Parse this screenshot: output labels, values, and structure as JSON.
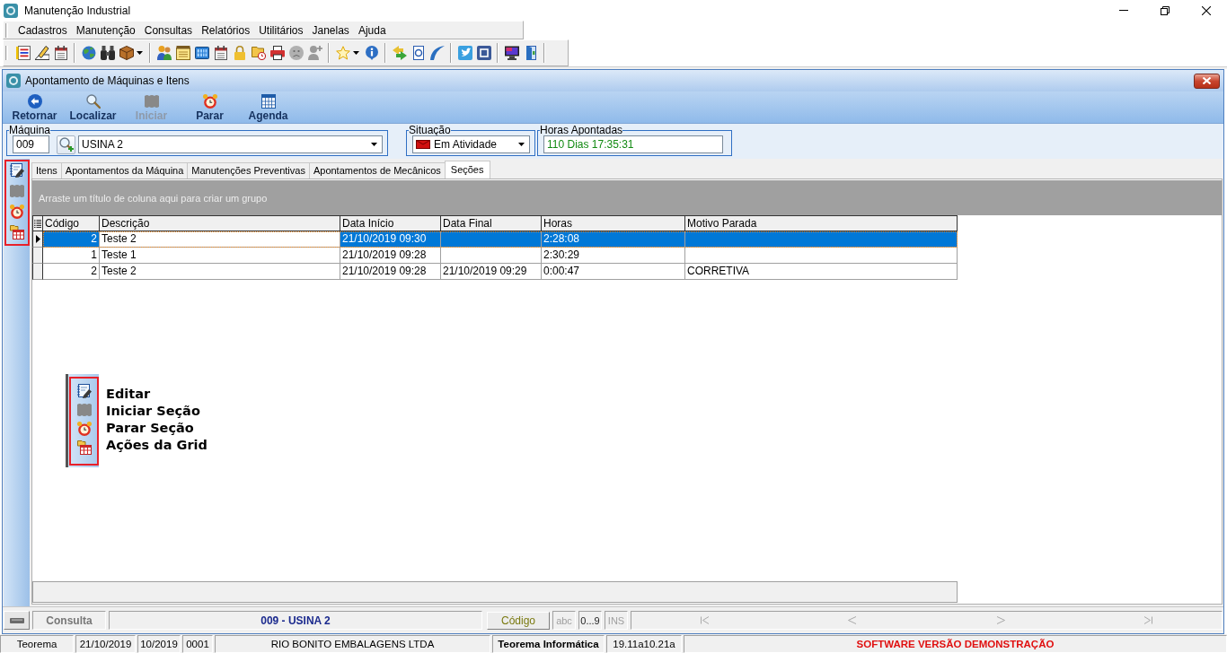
{
  "window": {
    "title": "Manutenção Industrial"
  },
  "menu": [
    {
      "label": "Cadastros"
    },
    {
      "label": "Manutenção"
    },
    {
      "label": "Consultas"
    },
    {
      "label": "Relatórios"
    },
    {
      "label": "Utilitários"
    },
    {
      "label": "Janelas"
    },
    {
      "label": "Ajuda"
    }
  ],
  "form": {
    "title": "Apontamento de Máquinas e Itens",
    "toolbar": [
      {
        "label": "Retornar",
        "disabled": false
      },
      {
        "label": "Localizar",
        "disabled": false
      },
      {
        "label": "Iniciar",
        "disabled": true
      },
      {
        "label": "Parar",
        "disabled": false
      },
      {
        "label": "Agenda",
        "disabled": false
      }
    ],
    "machine": {
      "label": "Máquina",
      "code": "009",
      "name": "USINA 2"
    },
    "situation": {
      "label": "Situação",
      "value": "Em Atividade"
    },
    "logged_hours": {
      "label": "Horas Apontadas",
      "value": "110 Dias 17:35:31"
    },
    "side_actions": [
      {
        "disabled": false
      },
      {
        "disabled": true
      },
      {
        "disabled": false
      },
      {
        "disabled": false
      }
    ],
    "tabs": [
      {
        "label": "Itens",
        "selected": false
      },
      {
        "label": "Apontamentos da Máquina",
        "selected": false
      },
      {
        "label": "Manutenções Preventivas",
        "selected": false
      },
      {
        "label": "Apontamentos de Mecânicos",
        "selected": false
      },
      {
        "label": "Seções",
        "selected": true
      }
    ],
    "grid": {
      "group_hint": "Arraste um título de coluna aqui para criar um grupo",
      "columns": [
        {
          "label": "Código",
          "kind": "number",
          "focused": false
        },
        {
          "label": "Descrição",
          "kind": "text",
          "focused": true
        },
        {
          "label": "Data Início",
          "kind": "text",
          "focused": false
        },
        {
          "label": "Data Final",
          "kind": "text",
          "focused": false
        },
        {
          "label": "Horas",
          "kind": "text",
          "focused": false
        },
        {
          "label": "Motivo Parada",
          "kind": "text",
          "focused": false
        }
      ],
      "rows": [
        {
          "cells": [
            "2",
            "Teste 2",
            "21/10/2019 09:30",
            null,
            "2:28:08",
            null
          ],
          "selected": true
        },
        {
          "cells": [
            "1",
            "Teste 1",
            "21/10/2019 09:28",
            null,
            "2:30:29",
            null
          ],
          "selected": false
        },
        {
          "cells": [
            "2",
            "Teste 2",
            "21/10/2019 09:28",
            "21/10/2019 09:29",
            "0:00:47",
            "CORRETIVA"
          ],
          "selected": false
        }
      ]
    },
    "legend": [
      {
        "label": "Editar",
        "disabled": false
      },
      {
        "label": "Iniciar Seção",
        "disabled": true
      },
      {
        "label": "Parar Seção",
        "disabled": false
      },
      {
        "label": "Ações da Grid",
        "disabled": false
      }
    ],
    "navigator": {
      "mode": "Consulta",
      "record": "009 - USINA 2",
      "sort_field": "Código",
      "indicators": [
        {
          "label": "abc",
          "on": false
        },
        {
          "label": "0...9",
          "on": true
        },
        {
          "label": "INS",
          "on": false
        }
      ]
    }
  },
  "status_bar": [
    {
      "text": "Teorema",
      "kind": "plain"
    },
    {
      "text": "21/10/2019",
      "kind": "plain"
    },
    {
      "text": "10/2019",
      "kind": "plain"
    },
    {
      "text": "0001",
      "kind": "plain"
    },
    {
      "text": "RIO BONITO EMBALAGENS LTDA",
      "kind": "plain"
    },
    {
      "text": "Teorema Informática",
      "kind": "bold"
    },
    {
      "text": "19.11a10.21a",
      "kind": "plain"
    },
    {
      "text": "SOFTWARE VERSÃO DEMONSTRAÇÃO",
      "kind": "alert"
    }
  ]
}
